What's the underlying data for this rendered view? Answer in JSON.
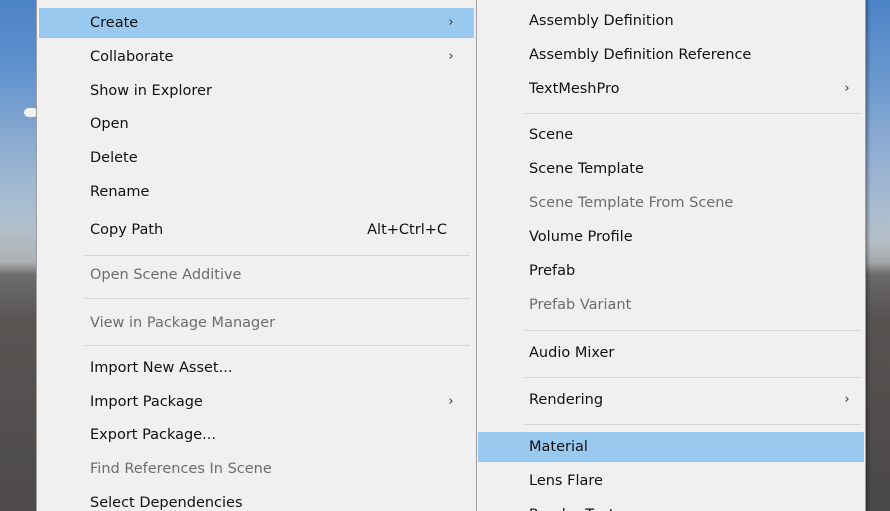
{
  "left_menu": {
    "items": [
      {
        "label": "Create",
        "submenu": "›"
      },
      {
        "label": "Collaborate",
        "submenu": "›"
      },
      {
        "label": "Show in Explorer"
      },
      {
        "label": "Open"
      },
      {
        "label": "Delete"
      },
      {
        "label": "Rename"
      },
      {
        "label": "Copy Path",
        "shortcut": "Alt+Ctrl+C"
      },
      {
        "label": "Open Scene Additive"
      },
      {
        "label": "View in Package Manager"
      },
      {
        "label": "Import New Asset..."
      },
      {
        "label": "Import Package",
        "submenu": "›"
      },
      {
        "label": "Export Package..."
      },
      {
        "label": "Find References In Scene"
      },
      {
        "label": "Select Dependencies"
      }
    ]
  },
  "right_menu": {
    "items": [
      {
        "label": "Assembly Definition"
      },
      {
        "label": "Assembly Definition Reference"
      },
      {
        "label": "TextMeshPro",
        "submenu": "›"
      },
      {
        "label": "Scene"
      },
      {
        "label": "Scene Template"
      },
      {
        "label": "Scene Template From Scene"
      },
      {
        "label": "Volume Profile"
      },
      {
        "label": "Prefab"
      },
      {
        "label": "Prefab Variant"
      },
      {
        "label": "Audio Mixer"
      },
      {
        "label": "Rendering",
        "submenu": "›"
      },
      {
        "label": "Material"
      },
      {
        "label": "Lens Flare"
      },
      {
        "label": "Render Texture"
      }
    ]
  },
  "colors": {
    "menu_background": "#f0f0f0",
    "highlight": "#99c9ef",
    "disabled_text": "#6d6d6d"
  }
}
